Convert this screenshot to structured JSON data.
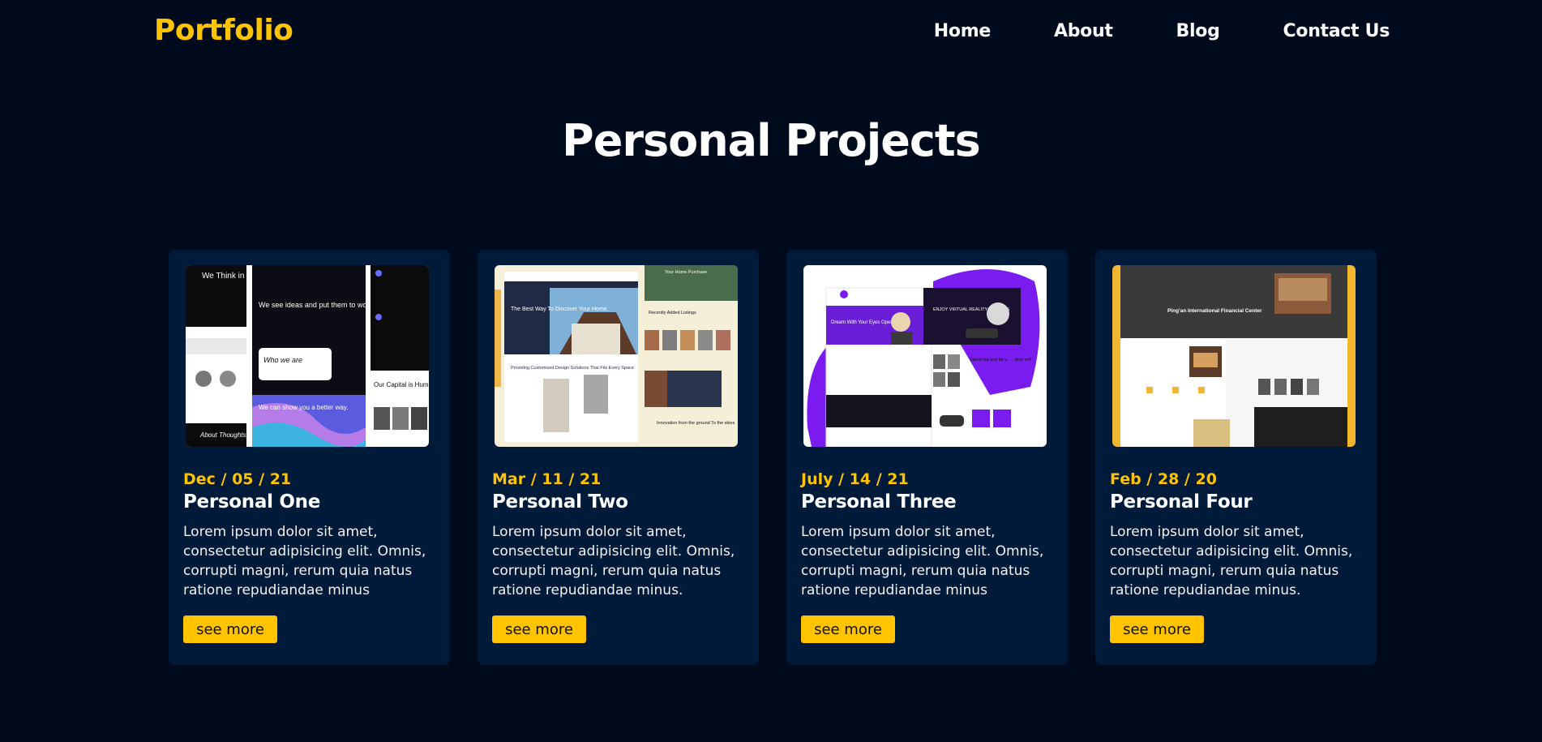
{
  "nav": {
    "logo": "Portfolio",
    "links": [
      "Home",
      "About",
      "Blog",
      "Contact Us"
    ]
  },
  "section": {
    "title": "Personal Projects"
  },
  "cards": [
    {
      "date": "Dec / 05 / 21",
      "title": "Personal One",
      "description": "Lorem ipsum dolor sit amet, consectetur adipisicing elit. Omnis, corrupti magni, rerum quia natus ratione repudiandae minus",
      "button": "see more",
      "thumb": {
        "t1": "We Think in Bold",
        "t2": "We see ideas and put them to work",
        "t3": "Who we are",
        "t4": "We can show you a better way.",
        "t5": "Our Capital is Human",
        "t6": "About Thoughts"
      }
    },
    {
      "date": "Mar / 11 / 21",
      "title": "Personal Two",
      "description": "Lorem ipsum dolor sit amet, consectetur adipisicing elit. Omnis, corrupti magni, rerum quia natus ratione repudiandae minus.",
      "button": "see more",
      "thumb": {
        "t1": "The Best Way To Discover Your Home.",
        "t2": "Providing Customized Design Solutions That Fits Every Space",
        "t3": "Your Home Purchase",
        "t4": "Recently Added Listings",
        "t5": "Innovation from the ground To the skies"
      }
    },
    {
      "date": "July / 14 / 21",
      "title": "Personal Three",
      "description": "Lorem ipsum dolor sit amet, consectetur adipisicing elit. Omnis, corrupti magni, rerum quia natus ratione repudiandae minus",
      "button": "see more",
      "thumb": {
        "t1": "Dream With Your Eyes Open",
        "t2": "ENJOY VIRTUAL REALITY GLASSES",
        "t3": "Stand out and be your best self"
      }
    },
    {
      "date": "Feb / 28 / 20",
      "title": "Personal Four",
      "description": "Lorem ipsum dolor sit amet, consectetur adipisicing elit. Omnis, corrupti magni, rerum quia natus ratione repudiandae minus.",
      "button": "see more",
      "thumb": {
        "t1": "Ping'an International Financial Center"
      }
    }
  ],
  "colors": {
    "background": "#000a1d",
    "card": "#001a3a",
    "accent": "#ffc300",
    "text": "#ffffff"
  }
}
